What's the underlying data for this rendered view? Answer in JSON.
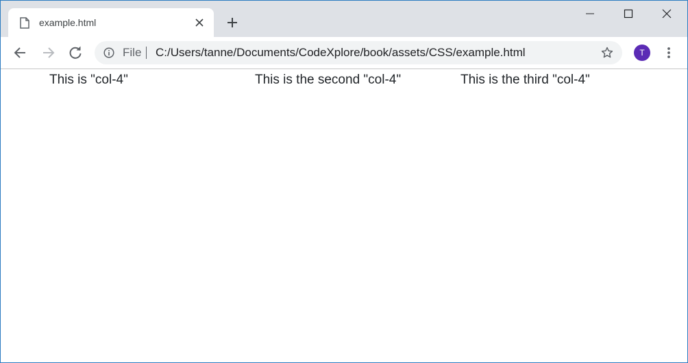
{
  "browser": {
    "tab": {
      "title": "example.html",
      "favicon": "file-icon"
    },
    "toolbar": {
      "back_icon": "arrow-left-icon",
      "forward_icon": "arrow-right-icon",
      "reload_icon": "reload-icon",
      "info_icon": "info-icon",
      "scheme_label": "File",
      "url": "C:/Users/tanne/Documents/CodeXplore/book/assets/CSS/example.html",
      "bookmark_icon": "star-icon",
      "profile_initial": "T",
      "menu_icon": "more-vert-icon"
    },
    "colors": {
      "tabstrip": "#dee1e6",
      "omnibox": "#f1f3f4",
      "avatar": "#5b2bb5",
      "window_border": "#2b7bc0"
    }
  },
  "page": {
    "columns": [
      {
        "text": "This is \"col-4\""
      },
      {
        "text": "This is the second \"col-4\""
      },
      {
        "text": "This is the third \"col-4\""
      }
    ]
  }
}
